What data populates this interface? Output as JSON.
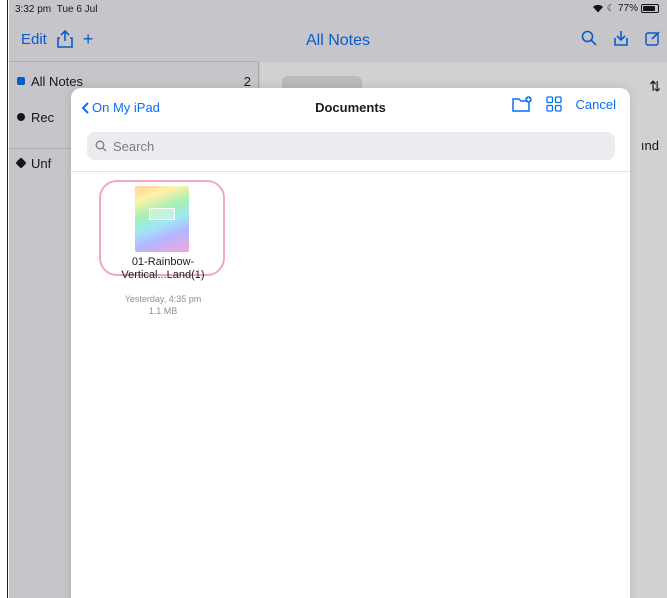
{
  "status_bar": {
    "time": "3:32 pm",
    "date": "Tue 6 Jul",
    "battery": "77%"
  },
  "toolbar": {
    "edit_label": "Edit",
    "title": "All Notes"
  },
  "sidebar": {
    "items": [
      {
        "label": "All Notes",
        "count": "2"
      },
      {
        "label": "Rec",
        "count": ""
      },
      {
        "label": "Unf",
        "count": ""
      }
    ]
  },
  "main": {
    "peek_text": "ınd"
  },
  "modal": {
    "back_label": "On My iPad",
    "title": "Documents",
    "cancel_label": "Cancel",
    "search_placeholder": "Search",
    "files": [
      {
        "name_line1": "01-Rainbow-",
        "name_line2": "Vertical...Land(1)",
        "date": "Yesterday, 4:35 pm",
        "size": "1.1 MB"
      }
    ]
  },
  "colors": {
    "accent": "#0a6ff5",
    "highlight": "#f1a7c4"
  }
}
